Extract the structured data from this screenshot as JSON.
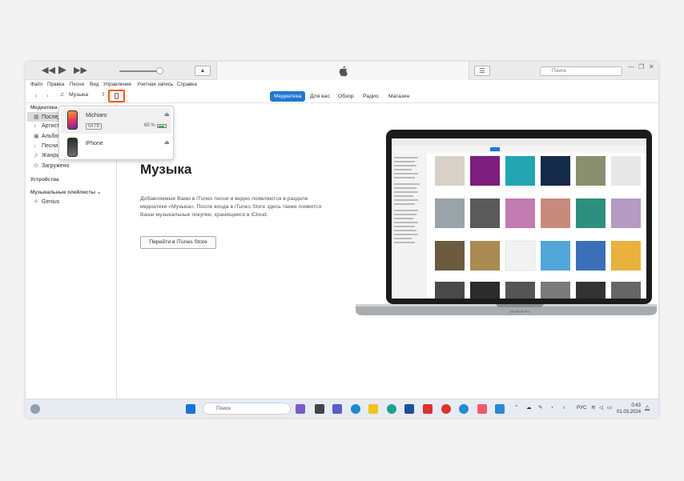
{
  "window": {
    "search_placeholder": "Поиск"
  },
  "menu": [
    "Файл",
    "Правка",
    "Песня",
    "Вид",
    "Управление",
    "Учетная запись",
    "Справка"
  ],
  "navbar": {
    "media_selector": "Музыка"
  },
  "tabs": [
    "Медиатека",
    "Для вас",
    "Обзор",
    "Радио",
    "Магазин"
  ],
  "sidebar": {
    "library_header": "Медиатека",
    "items": [
      "Последние",
      "Артисты",
      "Альбомы",
      "Песни",
      "Жанры",
      "Загружено"
    ],
    "devices_header": "Устройства",
    "playlists_header": "Музыкальные плейлисты",
    "playlists": [
      "Genius"
    ]
  },
  "devices_popup": {
    "device1": {
      "name": "Michiaro",
      "capacity": "64 ГБ",
      "battery": "65 %"
    },
    "device2": {
      "name": "iPhone"
    }
  },
  "main": {
    "title": "Музыка",
    "description": "Добавляемые Вами в iTunes песни и видео появляются в разделе медиатеки «Музыка». После входа в iTunes Store здесь также появятся Ваши музыкальные покупки, хранящиеся в iCloud.",
    "store_button": "Перейти в iTunes Store"
  },
  "laptop_label": "MacBook Pro",
  "taskbar": {
    "search_placeholder": "Поиск",
    "language": "РУС",
    "time": "0:43",
    "date": "01.03.2024"
  },
  "colors": {
    "accent": "#1f78d1",
    "highlight": "#ff5b12"
  }
}
